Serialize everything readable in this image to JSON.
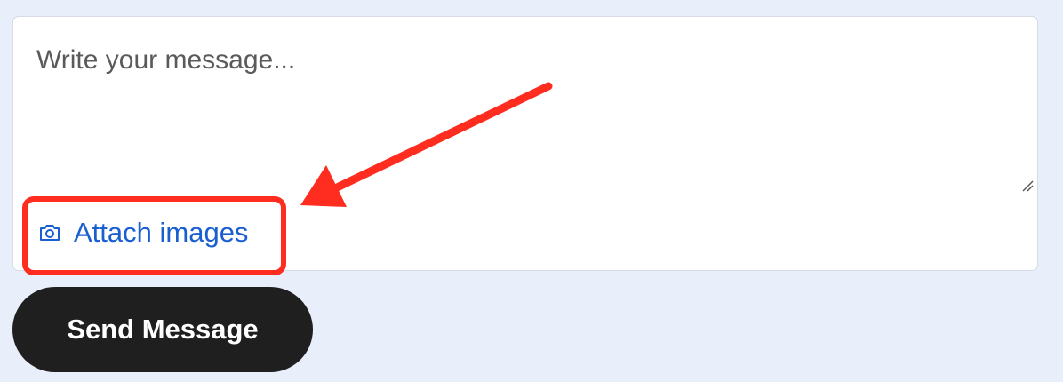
{
  "composer": {
    "message_placeholder": "Write your message...",
    "attach_label": "Attach images",
    "attach_icon": "camera-icon"
  },
  "actions": {
    "send_label": "Send Message"
  },
  "annotation": {
    "color": "#ff2d20",
    "target": "attach-images-link"
  },
  "theme": {
    "page_background": "#e8eefa",
    "link_color": "#1a5fd0",
    "button_background": "#1f1f1f",
    "button_text": "#ffffff"
  }
}
